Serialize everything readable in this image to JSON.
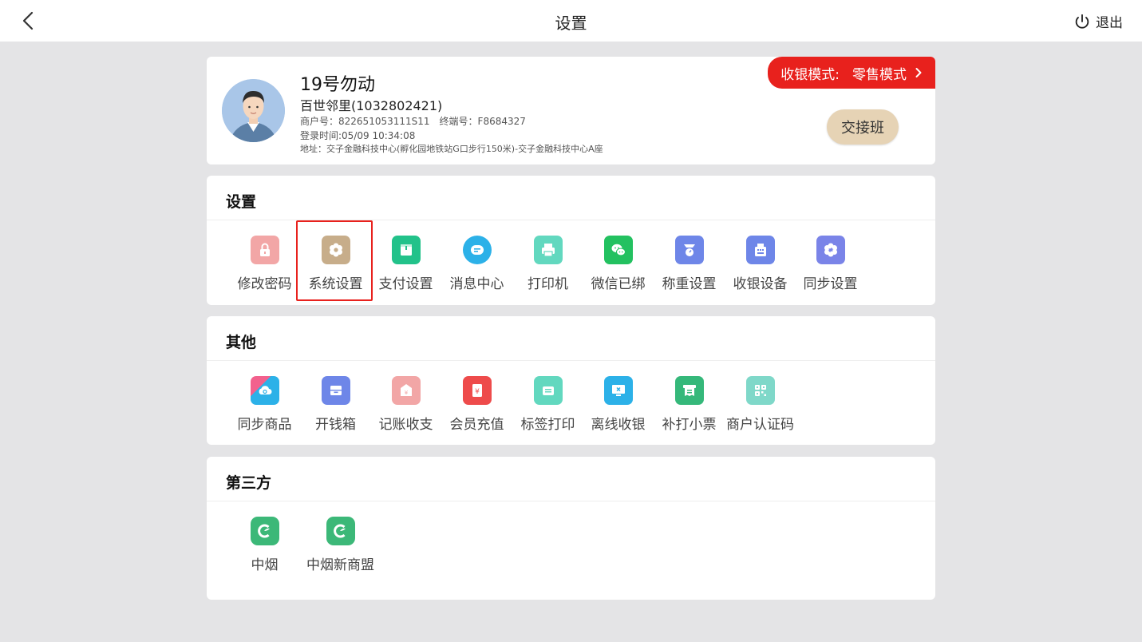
{
  "header": {
    "title": "设置",
    "logout_label": "退出"
  },
  "profile": {
    "shop_name": "19号勿动",
    "store_line": "百世邻里(1032802421)",
    "merchant_label": "商户号：",
    "merchant_no": "822651053111S11",
    "terminal_label": "终端号：",
    "terminal_no": "F8684327",
    "login_label": "登录时间:",
    "login_time": "05/09 10:34:08",
    "address_label": "地址：",
    "address": "交子金融科技中心(孵化园地铁站G口步行150米)-交子金融科技中心A座",
    "mode_label": "收银模式:",
    "mode_value": "零售模式",
    "shift_button": "交接班"
  },
  "settings_section": {
    "title": "设置",
    "items": [
      {
        "label": "修改密码",
        "icon": "lock-icon",
        "color": "#f2a6a6"
      },
      {
        "label": "系统设置",
        "icon": "gear-icon",
        "color": "#c7ad8a"
      },
      {
        "label": "支付设置",
        "icon": "wallet-icon",
        "color": "#22c28a"
      },
      {
        "label": "消息中心",
        "icon": "message-icon",
        "color": "#2cb1e8"
      },
      {
        "label": "打印机",
        "icon": "printer-icon",
        "color": "#62d8bf"
      },
      {
        "label": "微信已绑",
        "icon": "wechat-icon",
        "color": "#23c160"
      },
      {
        "label": "称重设置",
        "icon": "scale-icon",
        "color": "#6e86e8"
      },
      {
        "label": "收银设备",
        "icon": "pos-icon",
        "color": "#6e86e8"
      },
      {
        "label": "同步设置",
        "icon": "sync-settings-icon",
        "color": "#7a84e8"
      }
    ]
  },
  "others_section": {
    "title": "其他",
    "items": [
      {
        "label": "同步商品",
        "icon": "cloud-sync-icon",
        "color": "#2cb1e8"
      },
      {
        "label": "开钱箱",
        "icon": "cash-drawer-icon",
        "color": "#6e86e8"
      },
      {
        "label": "记账收支",
        "icon": "ledger-icon",
        "color": "#f2a6a6"
      },
      {
        "label": "会员充值",
        "icon": "yen-card-icon",
        "color": "#ee4b4b"
      },
      {
        "label": "标签打印",
        "icon": "label-printer-icon",
        "color": "#62d8bf"
      },
      {
        "label": "离线收银",
        "icon": "offline-icon",
        "color": "#2cb1e8"
      },
      {
        "label": "补打小票",
        "icon": "receipt-icon",
        "color": "#35b87a"
      },
      {
        "label": "商户认证码",
        "icon": "qr-code-icon",
        "color": "#7fd8c9"
      }
    ]
  },
  "third_section": {
    "title": "第三方",
    "items": [
      {
        "label": "中烟",
        "icon": "zhongyan-icon",
        "color": "#3cb878"
      },
      {
        "label": "中烟新商盟",
        "icon": "zhongyan-xinshangmeng-icon",
        "color": "#3cb878"
      }
    ]
  }
}
